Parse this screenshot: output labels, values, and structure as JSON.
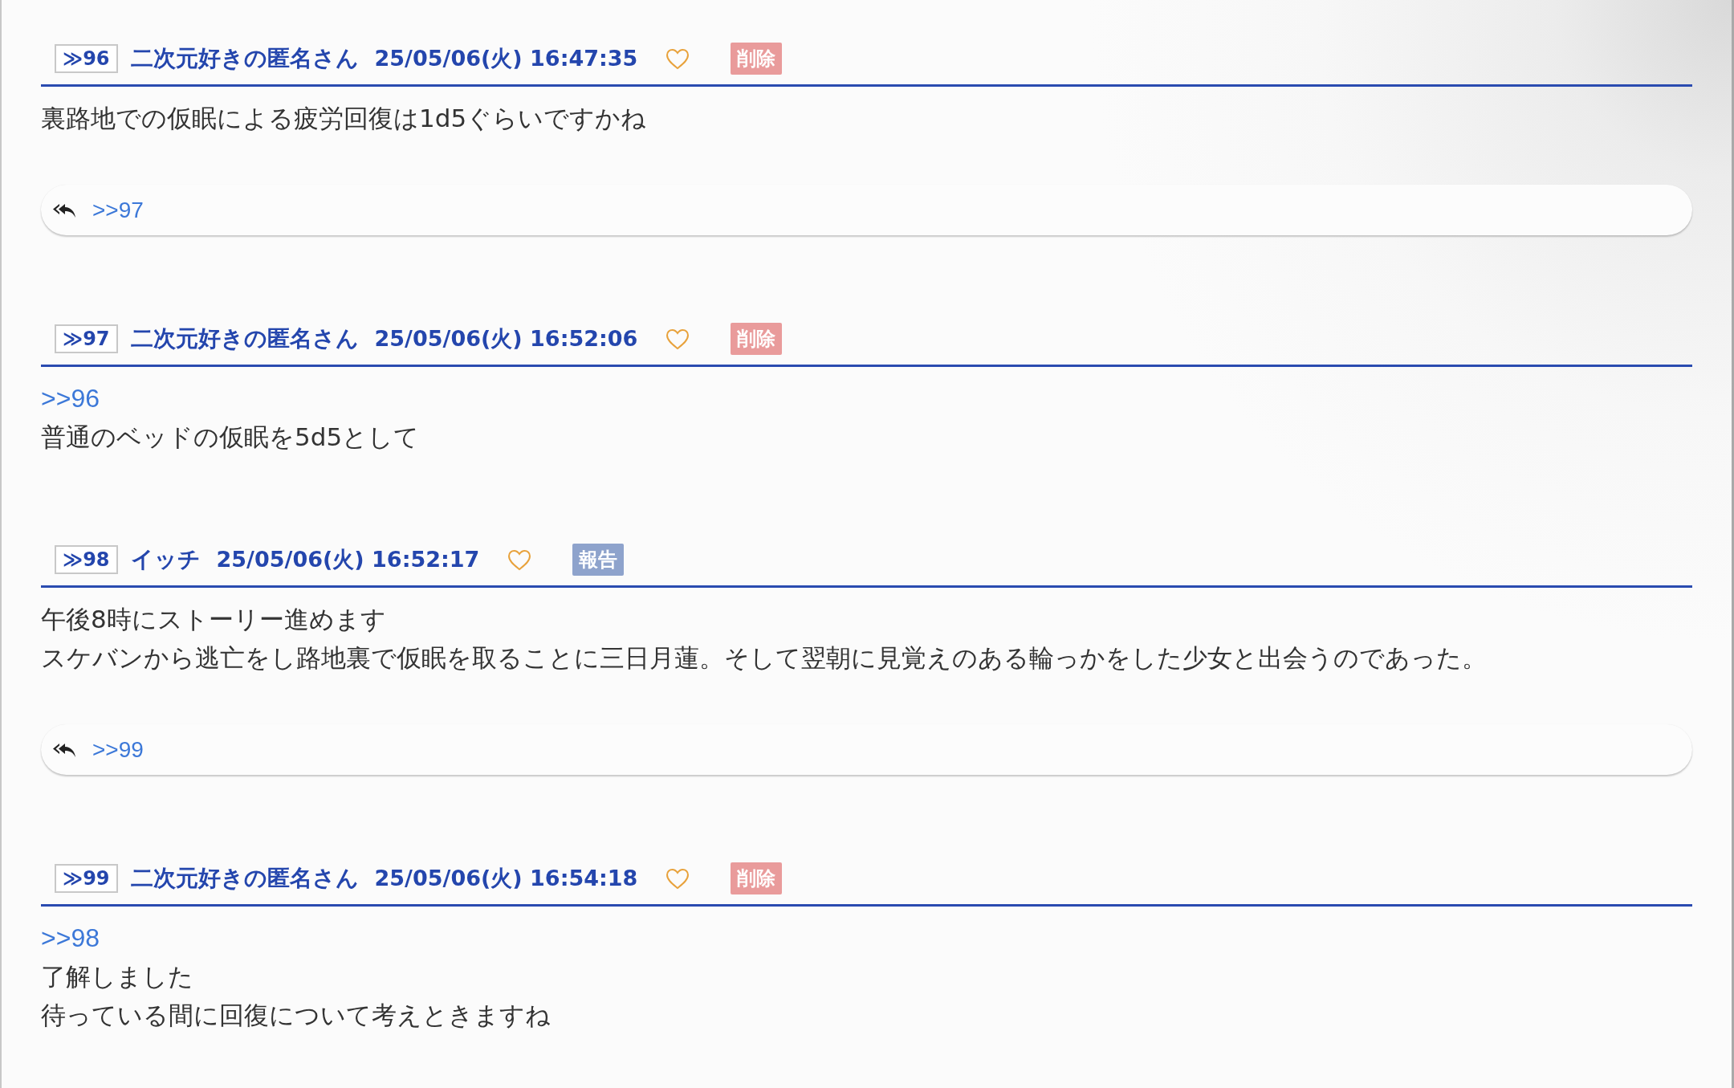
{
  "posts": [
    {
      "number": "≫96",
      "name": "二次元好きの匿名さん",
      "date": "25/05/06(火) 16:47:35",
      "action": {
        "kind": "delete",
        "label": "削除"
      },
      "lines": [
        "裏路地での仮眠による疲労回復は1d5ぐらいですかね"
      ],
      "replies": [
        ">>97"
      ]
    },
    {
      "number": "≫97",
      "name": "二次元好きの匿名さん",
      "date": "25/05/06(火) 16:52:06",
      "action": {
        "kind": "delete",
        "label": "削除"
      },
      "anchor": ">>96",
      "lines": [
        "普通のベッドの仮眠を5d5として"
      ]
    },
    {
      "number": "≫98",
      "name": "イッチ",
      "date": "25/05/06(火) 16:52:17",
      "action": {
        "kind": "report",
        "label": "報告"
      },
      "lines": [
        "午後8時にストーリー進めます",
        "スケバンから逃亡をし路地裏で仮眠を取ることに三日月蓮。そして翌朝に見覚えのある輪っかをした少女と出会うのであった。"
      ],
      "replies": [
        ">>99"
      ]
    },
    {
      "number": "≫99",
      "name": "二次元好きの匿名さん",
      "date": "25/05/06(火) 16:54:18",
      "action": {
        "kind": "delete",
        "label": "削除"
      },
      "anchor": ">>98",
      "lines": [
        "了解しました",
        "待っている間に回復について考えときますね"
      ]
    }
  ]
}
